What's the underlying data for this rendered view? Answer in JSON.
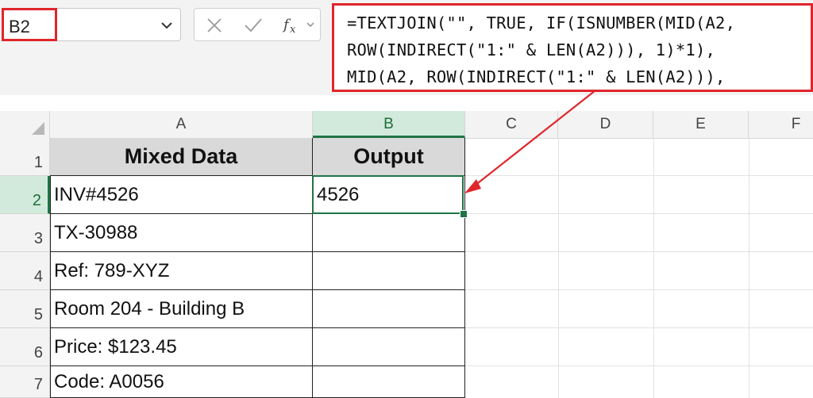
{
  "name_box": {
    "value": "B2"
  },
  "formula_bar": {
    "cancel_icon": "x-icon",
    "enter_icon": "check-icon",
    "function_icon": "fx-icon",
    "lines": [
      "=TEXTJOIN(\"\", TRUE, IF(ISNUMBER(MID(A2,",
      "ROW(INDIRECT(\"1:\" & LEN(A2))), 1)*1),",
      "MID(A2, ROW(INDIRECT(\"1:\" & LEN(A2))),"
    ]
  },
  "columns": [
    "A",
    "B",
    "C",
    "D",
    "E",
    "F"
  ],
  "selected_column": "B",
  "rows": [
    "1",
    "2",
    "3",
    "4",
    "5",
    "6",
    "7"
  ],
  "selected_row": "2",
  "table": {
    "headers": [
      "Mixed Data",
      "Output"
    ],
    "mixed_data": [
      "INV#4526",
      "TX-30988",
      "Ref: 789-XYZ",
      "Room 204 - Building B",
      "Price: $123.45",
      "Code: A0056"
    ],
    "output": [
      "4526",
      "",
      "",
      "",
      "",
      ""
    ]
  },
  "colors": {
    "highlight": "#e0262b",
    "selection": "#217346",
    "header_fill": "#d9d9d9"
  }
}
